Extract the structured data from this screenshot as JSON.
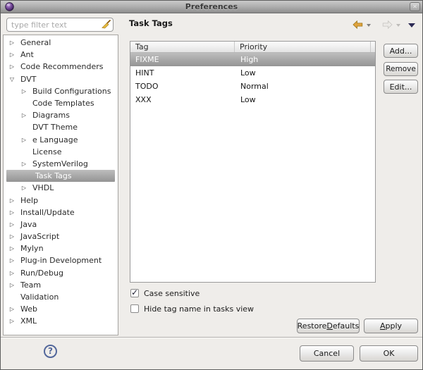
{
  "window": {
    "title": "Preferences"
  },
  "colors": {
    "selection_start": "#bdbdbd",
    "selection_end": "#949494",
    "selection_text": "#ffffff",
    "back_arrow": "#e0a33e",
    "menu_triangle": "#2c2a55",
    "help": "#52679b",
    "titlebar_text": "#3a3a3a"
  },
  "icons": {
    "close": "✕",
    "collapsed": "▷",
    "expanded": "▽",
    "check": "✓",
    "clear_filter": "broom-icon",
    "back": "back-arrow-icon",
    "forward": "forward-arrow-icon",
    "view_menu": "down-triangle-icon",
    "window_orb": "purple-orb-icon"
  },
  "sidebar": {
    "filter_placeholder": "type filter text",
    "items": [
      {
        "label": "General",
        "arrow": "collapsed",
        "level": 0
      },
      {
        "label": "Ant",
        "arrow": "collapsed",
        "level": 0
      },
      {
        "label": "Code Recommenders",
        "arrow": "collapsed",
        "level": 0
      },
      {
        "label": "DVT",
        "arrow": "expanded",
        "level": 0
      },
      {
        "label": "Build Configurations",
        "arrow": "collapsed",
        "level": 1
      },
      {
        "label": "Code Templates",
        "arrow": "none",
        "level": 1
      },
      {
        "label": "Diagrams",
        "arrow": "collapsed",
        "level": 1
      },
      {
        "label": "DVT Theme",
        "arrow": "none",
        "level": 1
      },
      {
        "label": "e Language",
        "arrow": "collapsed",
        "level": 1
      },
      {
        "label": "License",
        "arrow": "none",
        "level": 1
      },
      {
        "label": "SystemVerilog",
        "arrow": "collapsed",
        "level": 1
      },
      {
        "label": "Task Tags",
        "arrow": "none",
        "level": 1,
        "selected": true
      },
      {
        "label": "VHDL",
        "arrow": "collapsed",
        "level": 1
      },
      {
        "label": "Help",
        "arrow": "collapsed",
        "level": 0
      },
      {
        "label": "Install/Update",
        "arrow": "collapsed",
        "level": 0
      },
      {
        "label": "Java",
        "arrow": "collapsed",
        "level": 0
      },
      {
        "label": "JavaScript",
        "arrow": "collapsed",
        "level": 0
      },
      {
        "label": "Mylyn",
        "arrow": "collapsed",
        "level": 0
      },
      {
        "label": "Plug-in Development",
        "arrow": "collapsed",
        "level": 0
      },
      {
        "label": "Run/Debug",
        "arrow": "collapsed",
        "level": 0
      },
      {
        "label": "Team",
        "arrow": "collapsed",
        "level": 0
      },
      {
        "label": "Validation",
        "arrow": "none",
        "level": 0
      },
      {
        "label": "Web",
        "arrow": "collapsed",
        "level": 0
      },
      {
        "label": "XML",
        "arrow": "collapsed",
        "level": 0
      }
    ]
  },
  "header": {
    "title": "Task Tags"
  },
  "table": {
    "columns": [
      "Tag",
      "Priority"
    ],
    "rows": [
      {
        "tag": "FIXME",
        "priority": "High",
        "selected": true
      },
      {
        "tag": "HINT",
        "priority": "Low",
        "selected": false
      },
      {
        "tag": "TODO",
        "priority": "Normal",
        "selected": false
      },
      {
        "tag": "XXX",
        "priority": "Low",
        "selected": false
      }
    ]
  },
  "side_buttons": {
    "add": "Add...",
    "remove": "Remove",
    "edit": "Edit..."
  },
  "checkboxes": [
    {
      "label": "Case sensitive",
      "checked": true
    },
    {
      "label": "Hide tag name in tasks view",
      "checked": false
    }
  ],
  "action_buttons": {
    "restore_defaults": "Restore &Defaults",
    "apply": "&Apply"
  },
  "dialog_buttons": {
    "cancel": "Cancel",
    "ok": "OK"
  },
  "help": {
    "glyph": "?"
  }
}
